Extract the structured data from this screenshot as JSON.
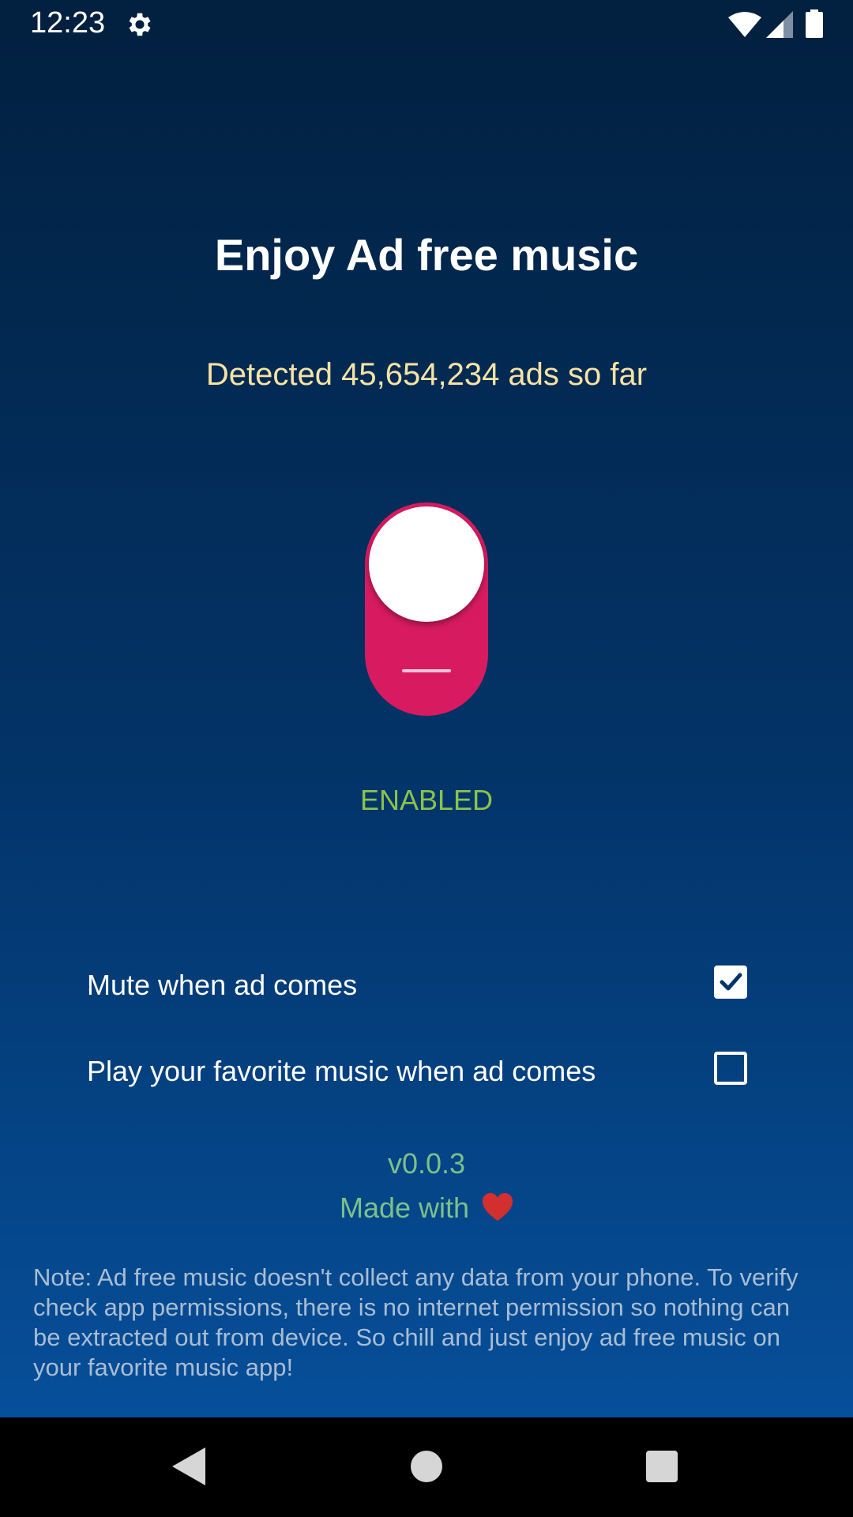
{
  "status_bar": {
    "time": "12:23",
    "icons": [
      "settings-icon",
      "wifi-icon",
      "signal-icon",
      "battery-icon"
    ]
  },
  "main": {
    "title": "Enjoy Ad free music",
    "detected_text": "Detected 45,654,234 ads so far",
    "toggle": {
      "state": "on",
      "status_label": "ENABLED",
      "track_color": "#d81b60",
      "knob_color": "#ffffff"
    },
    "options": [
      {
        "label": "Mute when ad comes",
        "checked": true
      },
      {
        "label": "Play your favorite music when ad comes",
        "checked": false
      }
    ],
    "version": "v0.0.3",
    "made_with": "Made with",
    "heart_icon": "heart-icon",
    "note": "Note: Ad free music doesn't collect any data from your phone. To verify check app permissions, there is no internet permission so nothing can be extracted out from device. So chill and just enjoy ad free music on your favorite music app!"
  },
  "colors": {
    "background_top": "#02203f",
    "background_bottom": "#064f9a",
    "accent_pink": "#d81b60",
    "enabled_green": "#8bc34a",
    "detected_yellow": "#f6e3a3",
    "footer_green": "#7cc08a"
  },
  "nav_bar": {
    "icons": [
      "back-icon",
      "home-icon",
      "recents-icon"
    ]
  }
}
